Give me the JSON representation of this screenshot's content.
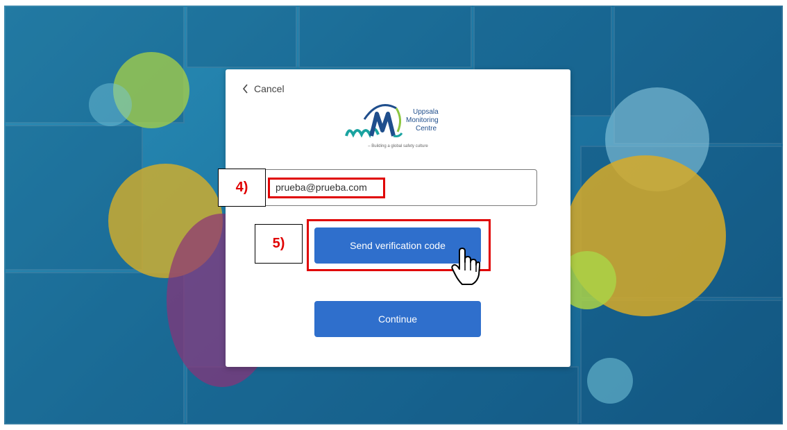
{
  "cancel": {
    "label": "Cancel",
    "icon": "chevron-left-icon"
  },
  "logo": {
    "name_lines": [
      "Uppsala",
      "Monitoring",
      "Centre"
    ],
    "tagline": "– Building a global safety culture",
    "colors": {
      "teal": "#1aa3a0",
      "navy": "#1f4e8c",
      "green": "#8cc63f"
    }
  },
  "email": {
    "value": "prueba@prueba.com"
  },
  "buttons": {
    "send": "Send verification code",
    "continue": "Continue"
  },
  "annotations": {
    "step4": "4)",
    "step5": "5)",
    "highlight_color": "#e00000"
  },
  "theme": {
    "button_bg": "#2f6fcc",
    "bg_blue": "#1f7aa6"
  }
}
